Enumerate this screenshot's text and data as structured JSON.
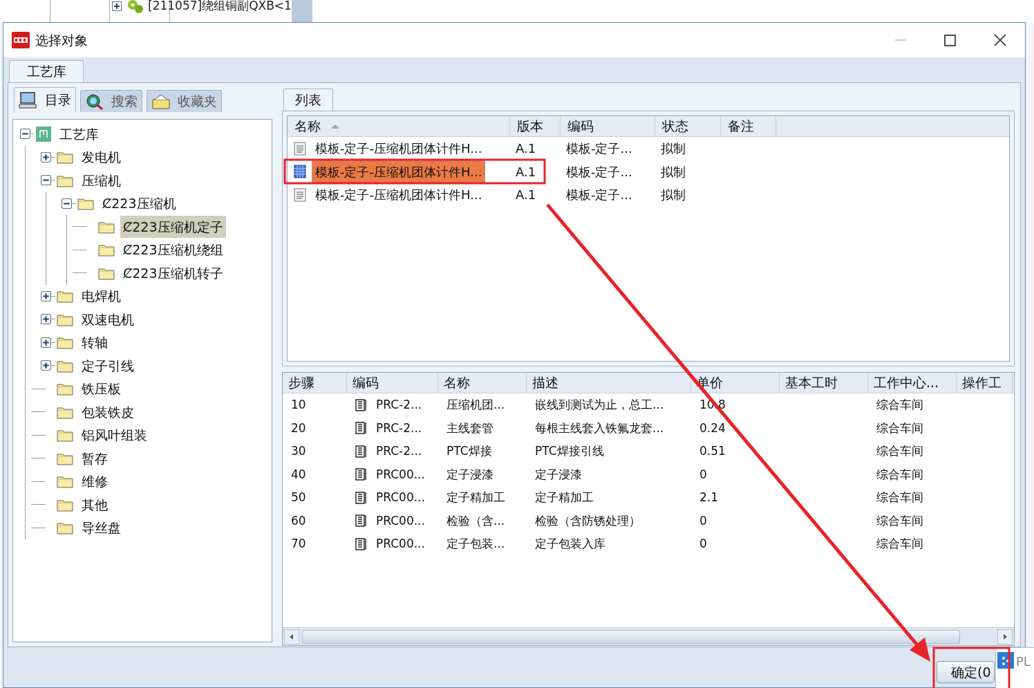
{
  "background_window": {
    "tree_item": "[211057]绕组铜副QXB<1"
  },
  "window": {
    "title": "选择对象"
  },
  "tabs": [
    {
      "label": "工艺库",
      "selected": true
    }
  ],
  "left_tabs": [
    {
      "label": "目录",
      "selected": true,
      "kind": "catalog"
    },
    {
      "label": "搜索",
      "selected": false,
      "kind": "search"
    },
    {
      "label": "收藏夹",
      "selected": false,
      "kind": "favorites"
    }
  ],
  "tree": [
    {
      "label": "工艺库",
      "kind": "library",
      "expanded": true,
      "selected": false,
      "children": [
        {
          "label": "发电机",
          "kind": "folder",
          "expanded": false,
          "selected": false
        },
        {
          "label": "压缩机",
          "kind": "folder",
          "expanded": true,
          "selected": false,
          "children": [
            {
              "label": "Ȼ223压缩机",
              "kind": "folder",
              "expanded": true,
              "selected": false,
              "children": [
                {
                  "label": "Ȼ223压缩机定子",
                  "kind": "folder",
                  "selected": true
                },
                {
                  "label": "Ȼ223压缩机绕组",
                  "kind": "folder",
                  "selected": false
                },
                {
                  "label": "Ȼ223压缩机转子",
                  "kind": "folder",
                  "selected": false
                }
              ]
            }
          ]
        },
        {
          "label": "电焊机",
          "kind": "folder",
          "expanded": false,
          "selected": false
        },
        {
          "label": "双速电机",
          "kind": "folder",
          "expanded": false,
          "selected": false
        },
        {
          "label": "转轴",
          "kind": "folder",
          "expanded": false,
          "selected": false
        },
        {
          "label": "定子引线",
          "kind": "folder",
          "expanded": false,
          "selected": false
        },
        {
          "label": "铁压板",
          "kind": "folder",
          "selected": false
        },
        {
          "label": "包装铁皮",
          "kind": "folder",
          "selected": false
        },
        {
          "label": "铝风叶组装",
          "kind": "folder",
          "selected": false
        },
        {
          "label": "暂存",
          "kind": "folder",
          "selected": false
        },
        {
          "label": "维修",
          "kind": "folder",
          "selected": false
        },
        {
          "label": "其他",
          "kind": "folder",
          "selected": false
        },
        {
          "label": "导丝盘",
          "kind": "folder",
          "selected": false
        }
      ]
    }
  ],
  "right_tabs": [
    {
      "label": "列表",
      "selected": true
    }
  ],
  "list": {
    "columns": [
      "名称",
      "版本",
      "编码",
      "状态",
      "备注"
    ],
    "rows": [
      {
        "cells": [
          "模板-定子-压缩机团体计件H...",
          "A.1",
          "模板-定子...",
          "拟制",
          ""
        ],
        "selected": false
      },
      {
        "cells": [
          "模板-定子-压缩机团体计件H...",
          "A.1",
          "模板-定子...",
          "拟制",
          ""
        ],
        "selected": true
      },
      {
        "cells": [
          "模板-定子-压缩机团体计件H...",
          "A.1",
          "模板-定子...",
          "拟制",
          ""
        ],
        "selected": false
      }
    ]
  },
  "steps": {
    "columns": [
      "步骤",
      "编码",
      "名称",
      "描述",
      "单价",
      "基本工时",
      "工作中心...",
      "操作工"
    ],
    "rows": [
      [
        "10",
        "PRC-2...",
        "压缩机团...",
        "嵌线到测试为止，总工...",
        "10.8",
        "",
        "综合车间",
        ""
      ],
      [
        "20",
        "PRC-2...",
        "主线套管",
        "每根主线套入铁氟龙套...",
        "0.24",
        "",
        "综合车间",
        ""
      ],
      [
        "30",
        "PRC-2...",
        "PTC焊接",
        "PTC焊接引线",
        "0.51",
        "",
        "综合车间",
        ""
      ],
      [
        "40",
        "PRC00...",
        "定子浸漆",
        "定子浸漆",
        "0",
        "",
        "综合车间",
        ""
      ],
      [
        "50",
        "PRC00...",
        "定子精加工",
        "定子精加工",
        "2.1",
        "",
        "综合车间",
        ""
      ],
      [
        "60",
        "PRC00...",
        "检验（含...",
        "检验（含防锈处理）",
        "0",
        "",
        "综合车间",
        ""
      ],
      [
        "70",
        "PRC00...",
        "定子包装...",
        "定子包装入库",
        "0",
        "",
        "综合车间",
        ""
      ]
    ]
  },
  "buttons": [
    "确定(0"
  ],
  "overlapping_window": {
    "title": "PL"
  }
}
